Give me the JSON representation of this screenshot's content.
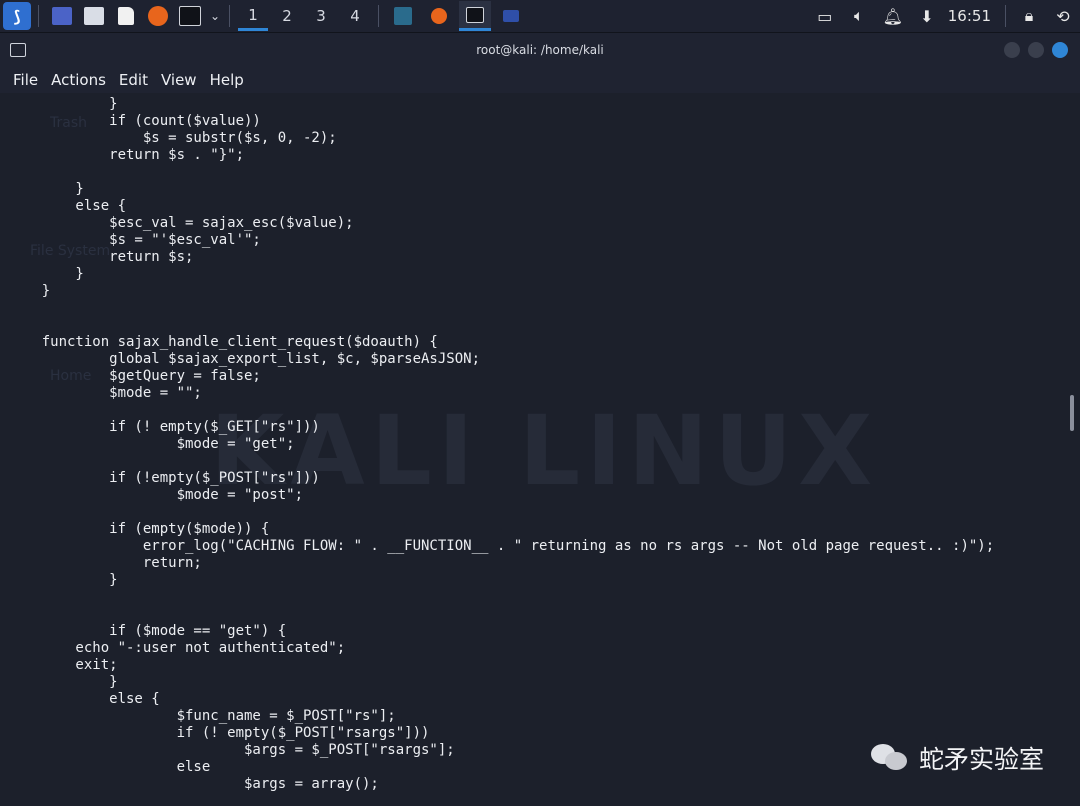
{
  "panel": {
    "workspaces": [
      "1",
      "2",
      "3",
      "4"
    ],
    "active_workspace": 0,
    "clock": "16:51",
    "colors": {
      "accent": "#2f86d6",
      "kali_blue": "#2f6fd0",
      "firefox": "#e8651c"
    }
  },
  "window": {
    "title": "root@kali: /home/kali"
  },
  "menubar": [
    "File",
    "Actions",
    "Edit",
    "View",
    "Help"
  ],
  "terminal": {
    "lines": [
      "            }",
      "            if (count($value))",
      "                $s = substr($s, 0, -2);",
      "            return $s . \"}\";",
      "",
      "        }",
      "        else {",
      "            $esc_val = sajax_esc($value);",
      "            $s = \"'$esc_val'\";",
      "            return $s;",
      "        }",
      "    }",
      "",
      "",
      "    function sajax_handle_client_request($doauth) {",
      "            global $sajax_export_list, $c, $parseAsJSON;",
      "            $getQuery = false;",
      "            $mode = \"\";",
      "",
      "            if (! empty($_GET[\"rs\"]))",
      "                    $mode = \"get\";",
      "",
      "            if (!empty($_POST[\"rs\"]))",
      "                    $mode = \"post\";",
      "",
      "            if (empty($mode)) {",
      "                error_log(\"CACHING FLOW: \" . __FUNCTION__ . \" returning as no rs args -- Not old page request.. :)\");",
      "                return;",
      "            }",
      "",
      "",
      "            if ($mode == \"get\") {",
      "        echo \"-:user not authenticated\";",
      "        exit;",
      "            }",
      "            else {",
      "                    $func_name = $_POST[\"rs\"];",
      "                    if (! empty($_POST[\"rsargs\"]))",
      "                            $args = $_POST[\"rsargs\"];",
      "                    else",
      "                            $args = array();"
    ],
    "watermark": "KALI LINUX",
    "desktop_labels": [
      "Trash",
      "File System",
      "Home"
    ]
  },
  "brand_watermark": "蛇矛实验室"
}
